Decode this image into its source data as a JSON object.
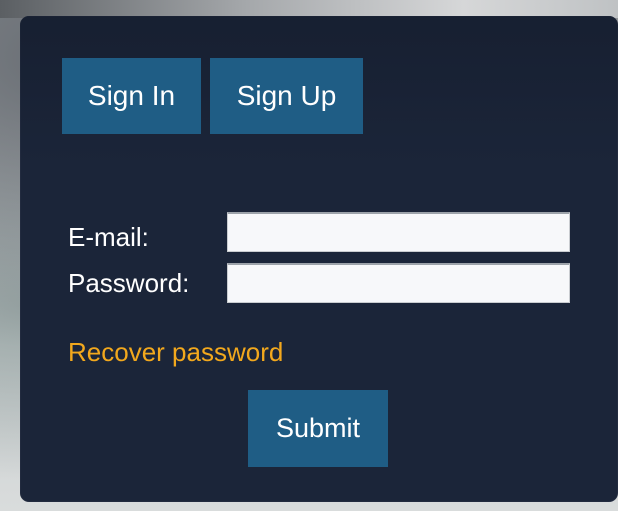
{
  "tabs": {
    "sign_in": "Sign In",
    "sign_up": "Sign Up"
  },
  "form": {
    "email_label": "E-mail:",
    "email_value": "",
    "password_label": "Password:",
    "password_value": "",
    "recover_link": "Recover password",
    "submit_label": "Submit"
  },
  "colors": {
    "panel_bg": "#1b2539",
    "button_bg": "#1f5d85",
    "link": "#f2a81d",
    "text": "#ffffff"
  }
}
